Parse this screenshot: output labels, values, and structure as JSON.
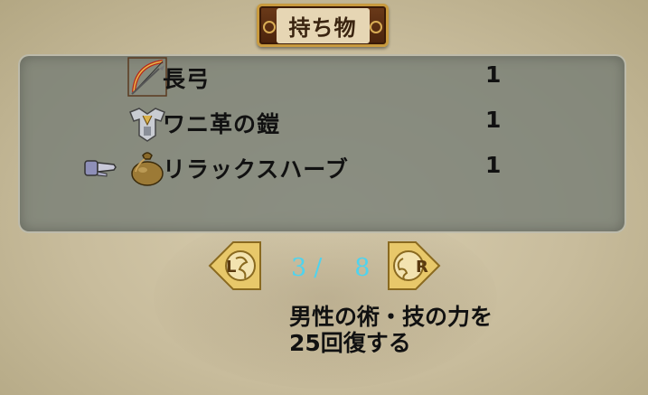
{
  "menu": {
    "title": "持ち物"
  },
  "items": [
    {
      "name": "長弓",
      "qty": "1",
      "icon": "bow-icon"
    },
    {
      "name": "ワニ革の鎧",
      "qty": "1",
      "icon": "armor-icon"
    },
    {
      "name": "リラックスハーブ",
      "qty": "1",
      "icon": "herb-pouch-icon"
    }
  ],
  "selected_index": 2,
  "pager": {
    "current": "3",
    "separator": "/",
    "total": "8",
    "prev_label": "L",
    "next_label": "R"
  },
  "description": {
    "line1": "男性の術・技の力を",
    "line2": "25回復する"
  },
  "colors": {
    "pager_text": "#4fd3ee",
    "title_frame": "#c89a3e",
    "panel": "#747c74"
  }
}
